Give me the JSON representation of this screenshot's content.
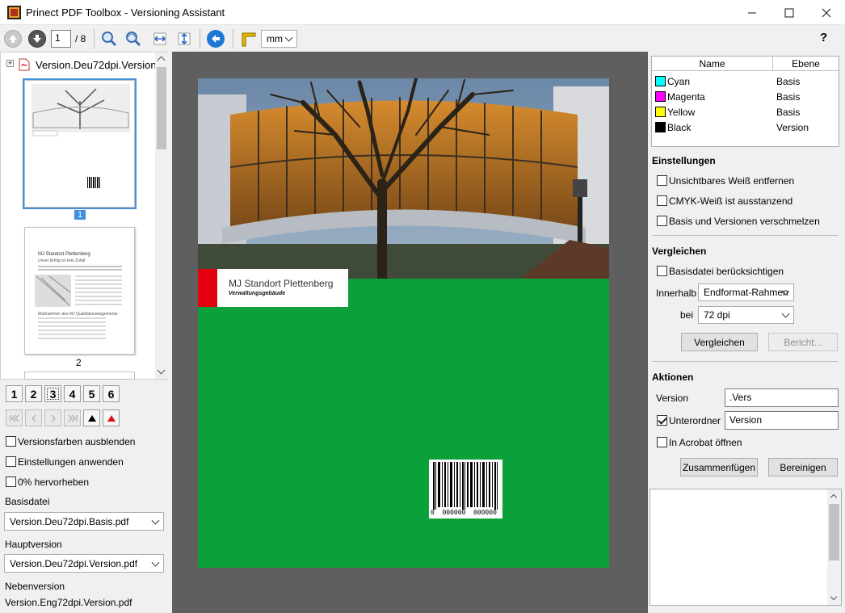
{
  "window": {
    "title": "Prinect PDF Toolbox  - Versioning Assistant"
  },
  "toolbar": {
    "page_current": "1",
    "page_total": "/ 8",
    "unit": "mm",
    "help": "?"
  },
  "left": {
    "file_name": "Version.Deu72dpi.Version",
    "thumb_labels": [
      "1",
      "2"
    ],
    "thumb2_text": [
      "MJ Standort Plettenberg",
      "Unser Erfolg ist kein Zufall",
      "Maßnahmen des MJ Qualitätsmanagements:"
    ],
    "number_buttons": [
      "1",
      "2",
      "3",
      "4",
      "5",
      "6"
    ],
    "checkboxes": [
      {
        "label": "Versionsfarben ausblenden",
        "checked": false
      },
      {
        "label": "Einstellungen anwenden",
        "checked": false
      },
      {
        "label": "0% hervorheben",
        "checked": false
      }
    ],
    "basisdatei_label": "Basisdatei",
    "basisdatei_value": "Version.Deu72dpi.Basis.pdf",
    "hauptversion_label": "Hauptversion",
    "hauptversion_value": "Version.Deu72dpi.Version.pdf",
    "nebenversion_label": "Nebenversion",
    "nebenversion_value": "Version.Eng72dpi.Version.pdf"
  },
  "page": {
    "heading": "MJ Standort Plettenberg",
    "subheading": "Verwaltungsgebäude",
    "barcode_digits": "0  000000  000000"
  },
  "right": {
    "table": {
      "col_name": "Name",
      "col_ebene": "Ebene",
      "rows": [
        {
          "name": "Cyan",
          "ebene": "Basis",
          "color": "#00ffff"
        },
        {
          "name": "Magenta",
          "ebene": "Basis",
          "color": "#ff00ff"
        },
        {
          "name": "Yellow",
          "ebene": "Basis",
          "color": "#ffff00"
        },
        {
          "name": "Black",
          "ebene": "Version",
          "color": "#000000"
        }
      ]
    },
    "einstellungen": {
      "title": "Einstellungen",
      "options": [
        {
          "label": "Unsichtbares Weiß entfernen",
          "checked": false
        },
        {
          "label": "CMYK-Weiß ist ausstanzend",
          "checked": false
        },
        {
          "label": "Basis und Versionen verschmelzen",
          "checked": false
        }
      ]
    },
    "vergleichen": {
      "title": "Vergleichen",
      "basisdatei_label": "Basisdatei berücksichtigen",
      "innerhalb_label": "Innerhalb",
      "innerhalb_value": "Endformat-Rahmen",
      "bei_label": "bei",
      "bei_value": "72 dpi",
      "compare_button": "Vergleichen",
      "report_button": "Bericht..."
    },
    "aktionen": {
      "title": "Aktionen",
      "version_label": "Version",
      "version_value": ".Vers",
      "unterordner_label": "Unterordner",
      "unterordner_value": "Version",
      "acrobat_label": "In Acrobat öffnen",
      "merge_button": "Zusammenfügen",
      "clean_button": "Bereinigen"
    }
  }
}
